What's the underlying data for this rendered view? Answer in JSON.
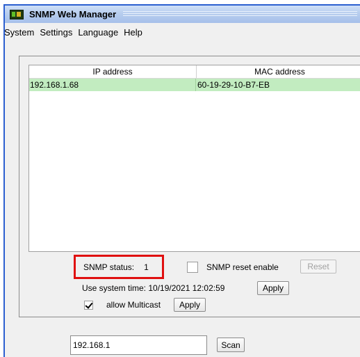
{
  "window": {
    "title": "SNMP Web Manager"
  },
  "menu": {
    "items": [
      "System",
      "Settings",
      "Language",
      "Help"
    ]
  },
  "table": {
    "columns": [
      "IP address",
      "MAC address"
    ],
    "rows": [
      {
        "ip": "192.168.1.68",
        "mac": "60-19-29-10-B7-EB"
      }
    ]
  },
  "snmp": {
    "status_label": "SNMP status:",
    "status_value": "1"
  },
  "reset": {
    "checkbox_label": "SNMP reset enable",
    "checked": false,
    "button_label": "Reset"
  },
  "system_time": {
    "label": "Use system time:  10/19/2021 12:02:59",
    "apply_label": "Apply"
  },
  "multicast": {
    "label": "allow Multicast",
    "checked": true,
    "apply_label": "Apply"
  },
  "scan": {
    "ip_value": "192.168.1",
    "button_label": "Scan"
  },
  "colors": {
    "selected_row": "#c2ecc0",
    "highlight_border": "#e01010",
    "window_border": "#2b5fd0"
  }
}
